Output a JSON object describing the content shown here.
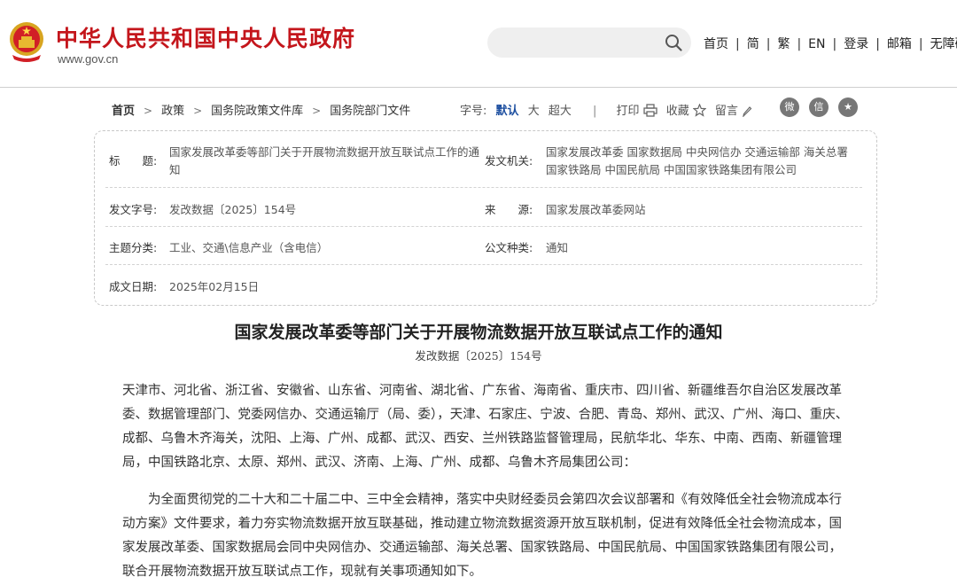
{
  "header": {
    "site_name": "中华人民共和国中央人民政府",
    "site_url": "www.gov.cn",
    "search": {
      "placeholder": ""
    },
    "links": [
      "首页",
      "简",
      "繁",
      "EN",
      "登录",
      "邮箱",
      "无障碍"
    ]
  },
  "breadcrumb": [
    "首页",
    "政策",
    "国务院政策文件库",
    "国务院部门文件"
  ],
  "toolbar": {
    "font_size_label": "字号:",
    "font_sizes": [
      "默认",
      "大",
      "超大"
    ],
    "active_font_size": "默认",
    "print_label": "打印",
    "favorite_label": "收藏",
    "comment_label": "留言",
    "share_icons": [
      "weibo-icon",
      "wechat-icon",
      "star-share-icon"
    ]
  },
  "info_box": {
    "title_label": "标　　题:",
    "title_line1": "国家发展改革委等部门关于开展物流数据开放互联试点工作的通",
    "title_line2": "知",
    "issuer_label": "发文机关:",
    "issuer_line1": "国家发展改革委  国家数据局  中央网信办  交通运输部  海关总署",
    "issuer_line2": "国家铁路局  中国民航局  中国国家铁路集团有限公司",
    "doc_no_label": "发文字号:",
    "doc_no": "发改数据〔2025〕154号",
    "source_label": "来　　源:",
    "source": "国家发展改革委网站",
    "category_label": "主题分类:",
    "category": "工业、交通\\信息产业（含电信）",
    "doc_type_label": "公文种类:",
    "doc_type": "通知",
    "date_label": "成文日期:",
    "date": "2025年02月15日"
  },
  "article": {
    "title": "国家发展改革委等部门关于开展物流数据开放互联试点工作的通知",
    "doc_no": "发改数据〔2025〕154号",
    "paragraphs": [
      "天津市、河北省、浙江省、安徽省、山东省、河南省、湖北省、广东省、海南省、重庆市、四川省、新疆维吾尔自治区发展改革委、数据管理部门、党委网信办、交通运输厅（局、委），天津、石家庄、宁波、合肥、青岛、郑州、武汉、广州、海口、重庆、成都、乌鲁木齐海关，沈阳、上海、广州、成都、武汉、西安、兰州铁路监督管理局，民航华北、华东、中南、西南、新疆管理局，中国铁路北京、太原、郑州、武汉、济南、上海、广州、成都、乌鲁木齐局集团公司：",
      "为全面贯彻党的二十大和二十届二中、三中全会精神，落实中央财经委员会第四次会议部署和《有效降低全社会物流成本行动方案》文件要求，着力夯实物流数据开放互联基础，推动建立物流数据资源开放互联机制，促进有效降低全社会物流成本，国家发展改革委、国家数据局会同中央网信办、交通运输部、海关总署、国家铁路局、中国民航局、中国国家铁路集团有限公司，联合开展物流数据开放互联试点工作，现就有关事项通知如下。"
    ]
  },
  "colors": {
    "brand_red": "#c4161c",
    "accent_blue": "#1d4fa0"
  }
}
